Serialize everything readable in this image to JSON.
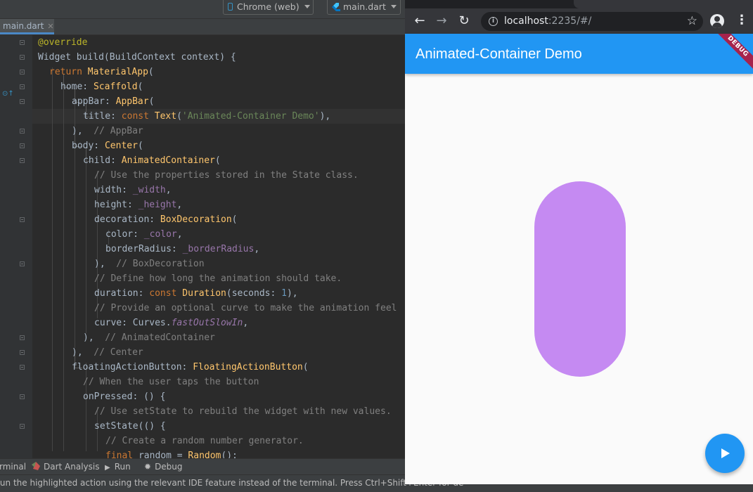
{
  "ide": {
    "device_selector": "Chrome (web)",
    "file_selector": "main.dart",
    "editor_tab": "main.dart",
    "code_lines": [
      [
        {
          "t": "@override",
          "c": "ann"
        }
      ],
      [
        {
          "t": "Widget build(BuildContext context) {",
          "c": ""
        }
      ],
      [
        {
          "t": "return ",
          "c": "kw"
        },
        {
          "t": "MaterialApp",
          "c": "cls"
        },
        {
          "t": "(",
          "c": ""
        }
      ],
      [
        {
          "t": "home: ",
          "c": ""
        },
        {
          "t": "Scaffold",
          "c": "cls"
        },
        {
          "t": "(",
          "c": ""
        }
      ],
      [
        {
          "t": "appBar: ",
          "c": ""
        },
        {
          "t": "AppBar",
          "c": "cls"
        },
        {
          "t": "(",
          "c": ""
        }
      ],
      [
        {
          "t": "title: ",
          "c": ""
        },
        {
          "t": "const ",
          "c": "kw"
        },
        {
          "t": "Text",
          "c": "cls"
        },
        {
          "t": "(",
          "c": ""
        },
        {
          "t": "'Animated-Container Demo'",
          "c": "str"
        },
        {
          "t": "),",
          "c": ""
        }
      ],
      [
        {
          "t": "),",
          "c": ""
        },
        {
          "t": "  // AppBar",
          "c": "cm"
        }
      ],
      [
        {
          "t": "body: ",
          "c": ""
        },
        {
          "t": "Center",
          "c": "cls"
        },
        {
          "t": "(",
          "c": ""
        }
      ],
      [
        {
          "t": "child: ",
          "c": ""
        },
        {
          "t": "AnimatedContainer",
          "c": "cls"
        },
        {
          "t": "(",
          "c": ""
        }
      ],
      [
        {
          "t": "// Use the properties stored in the State class.",
          "c": "cm"
        }
      ],
      [
        {
          "t": "width: ",
          "c": ""
        },
        {
          "t": "_width",
          "c": "fld"
        },
        {
          "t": ",",
          "c": ""
        }
      ],
      [
        {
          "t": "height: ",
          "c": ""
        },
        {
          "t": "_height",
          "c": "fld"
        },
        {
          "t": ",",
          "c": ""
        }
      ],
      [
        {
          "t": "decoration: ",
          "c": ""
        },
        {
          "t": "BoxDecoration",
          "c": "cls"
        },
        {
          "t": "(",
          "c": ""
        }
      ],
      [
        {
          "t": "color: ",
          "c": ""
        },
        {
          "t": "_color",
          "c": "fld"
        },
        {
          "t": ",",
          "c": ""
        }
      ],
      [
        {
          "t": "borderRadius: ",
          "c": ""
        },
        {
          "t": "_borderRadius",
          "c": "fld"
        },
        {
          "t": ",",
          "c": ""
        }
      ],
      [
        {
          "t": "),",
          "c": ""
        },
        {
          "t": "  // BoxDecoration",
          "c": "cm"
        }
      ],
      [
        {
          "t": "// Define how long the animation should take.",
          "c": "cm"
        }
      ],
      [
        {
          "t": "duration: ",
          "c": ""
        },
        {
          "t": "const ",
          "c": "kw"
        },
        {
          "t": "Duration",
          "c": "cls"
        },
        {
          "t": "(seconds: ",
          "c": ""
        },
        {
          "t": "1",
          "c": "num"
        },
        {
          "t": "),",
          "c": ""
        }
      ],
      [
        {
          "t": "// Provide an optional curve to make the animation feel",
          "c": "cm"
        }
      ],
      [
        {
          "t": "curve: Curves.",
          "c": ""
        },
        {
          "t": "fastOutSlowIn",
          "c": "it"
        },
        {
          "t": ",",
          "c": ""
        }
      ],
      [
        {
          "t": "),",
          "c": ""
        },
        {
          "t": "  // AnimatedContainer",
          "c": "cm"
        }
      ],
      [
        {
          "t": "),",
          "c": ""
        },
        {
          "t": "  // Center",
          "c": "cm"
        }
      ],
      [
        {
          "t": "floatingActionButton: ",
          "c": ""
        },
        {
          "t": "FloatingActionButton",
          "c": "cls"
        },
        {
          "t": "(",
          "c": ""
        }
      ],
      [
        {
          "t": "// When the user taps the button",
          "c": "cm"
        }
      ],
      [
        {
          "t": "onPressed: () {",
          "c": ""
        }
      ],
      [
        {
          "t": "// Use setState to rebuild the widget with new values.",
          "c": "cm"
        }
      ],
      [
        {
          "t": "setState(() {",
          "c": ""
        }
      ],
      [
        {
          "t": "// Create a random number generator.",
          "c": "cm"
        }
      ],
      [
        {
          "t": "final ",
          "c": "kw"
        },
        {
          "t": "random = ",
          "c": ""
        },
        {
          "t": "Random",
          "c": "cls"
        },
        {
          "t": "();",
          "c": ""
        }
      ]
    ],
    "bottom_tools": [
      "rminal",
      "Dart Analysis",
      "Run",
      "Debug"
    ],
    "status_text": "run the highlighted action using the relevant IDE feature instead of the terminal. Press Ctrl+Shift+Enter for de"
  },
  "browser": {
    "url_host": "localhost",
    "url_rest": ":2235/#/",
    "app_title": "Animated-Container Demo",
    "debug_banner": "DEBUG",
    "box_color": "#c58af2",
    "accent_color": "#2196f3"
  }
}
